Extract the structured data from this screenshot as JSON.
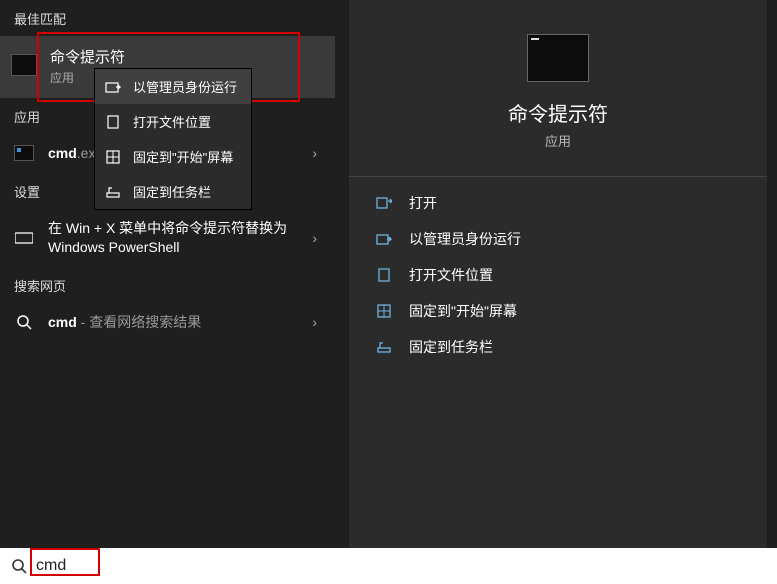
{
  "left": {
    "sections": {
      "best_match": "最佳匹配",
      "apps": "应用",
      "settings": "设置",
      "web": "搜索网页"
    },
    "best": {
      "title": "命令提示符",
      "subtitle": "应用"
    },
    "context_menu": [
      "以管理员身份运行",
      "打开文件位置",
      "固定到\"开始\"屏幕",
      "固定到任务栏"
    ],
    "apps_item": {
      "label": "cmd",
      "suffix": ".exe"
    },
    "settings_item": "在 Win + X 菜单中将命令提示符替换为 Windows PowerShell",
    "web_item": {
      "label": "cmd",
      "suffix": " - 查看网络搜索结果"
    }
  },
  "right": {
    "title": "命令提示符",
    "subtitle": "应用",
    "actions": [
      "打开",
      "以管理员身份运行",
      "打开文件位置",
      "固定到\"开始\"屏幕",
      "固定到任务栏"
    ]
  },
  "search": {
    "value": "cmd"
  }
}
